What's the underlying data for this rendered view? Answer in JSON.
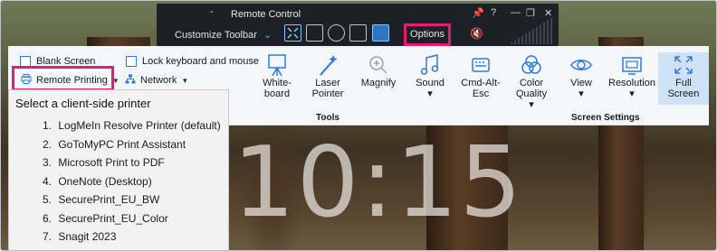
{
  "window": {
    "title": "Remote Control",
    "title_dash": "-",
    "customize_label": "Customize Toolbar",
    "options_label": "Options"
  },
  "ribbon": {
    "blank_screen": "Blank Screen",
    "lock_keyboard": "Lock keyboard and mouse",
    "remote_printing": "Remote Printing",
    "network": "Network",
    "tools_group_label": "Tools",
    "screen_settings_group_label": "Screen Settings",
    "buttons": [
      {
        "id": "whiteboard",
        "line1": "White-",
        "line2": "board",
        "icon": "easel-icon"
      },
      {
        "id": "laser",
        "line1": "Laser",
        "line2": "Pointer",
        "icon": "laser-wand-icon"
      },
      {
        "id": "magnify",
        "line1": "Magnify",
        "line2": "",
        "icon": "magnifier-icon"
      },
      {
        "id": "sound",
        "line1": "Sound",
        "line2": "▾",
        "icon": "music-note-icon"
      },
      {
        "id": "cad",
        "line1": "Cmd-Alt-",
        "line2": "Esc",
        "icon": "keyboard-icon"
      },
      {
        "id": "color",
        "line1": "Color",
        "line2": "Quality",
        "line3": "▾",
        "icon": "color-circles-icon"
      },
      {
        "id": "view",
        "line1": "View",
        "line2": "▾",
        "icon": "eye-icon"
      },
      {
        "id": "resolution",
        "line1": "Resolution",
        "line2": "▾",
        "icon": "resolution-icon"
      },
      {
        "id": "fullscreen",
        "line1": "Full",
        "line2": "Screen",
        "icon": "fullscreen-arrows-icon"
      }
    ]
  },
  "printer_menu": {
    "title": "Select a client-side printer",
    "items": [
      {
        "num": "1.",
        "label": "LogMeIn Resolve Printer (default)"
      },
      {
        "num": "2.",
        "label": "GoToMyPC Print Assistant"
      },
      {
        "num": "3.",
        "label": "Microsoft Print to PDF"
      },
      {
        "num": "4.",
        "label": "OneNote (Desktop)"
      },
      {
        "num": "5.",
        "label": "SecurePrint_EU_BW"
      },
      {
        "num": "6.",
        "label": "SecurePrint_EU_Color"
      },
      {
        "num": "7.",
        "label": "Snagit 2023"
      }
    ]
  },
  "background": {
    "clock": "10:15"
  },
  "colors": {
    "accent": "#2f7ad8",
    "highlight": "#e11d74",
    "titlebar": "#1c2127"
  }
}
